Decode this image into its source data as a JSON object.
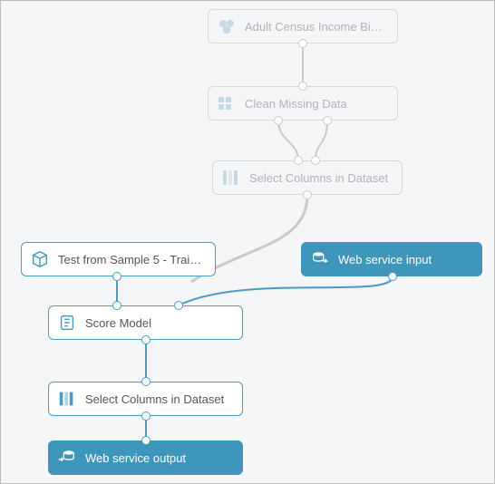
{
  "diagram": {
    "nodes": {
      "dataset": {
        "label": "Adult Census Income Binary C..."
      },
      "clean": {
        "label": "Clean Missing Data"
      },
      "selectGhost": {
        "label": "Select Columns in Dataset"
      },
      "trainedModel": {
        "label": "Test from Sample 5 - Training..."
      },
      "wsInput": {
        "label": "Web service input"
      },
      "score": {
        "label": "Score Model"
      },
      "selectActive": {
        "label": "Select Columns in Dataset"
      },
      "wsOutput": {
        "label": "Web service output"
      }
    }
  }
}
